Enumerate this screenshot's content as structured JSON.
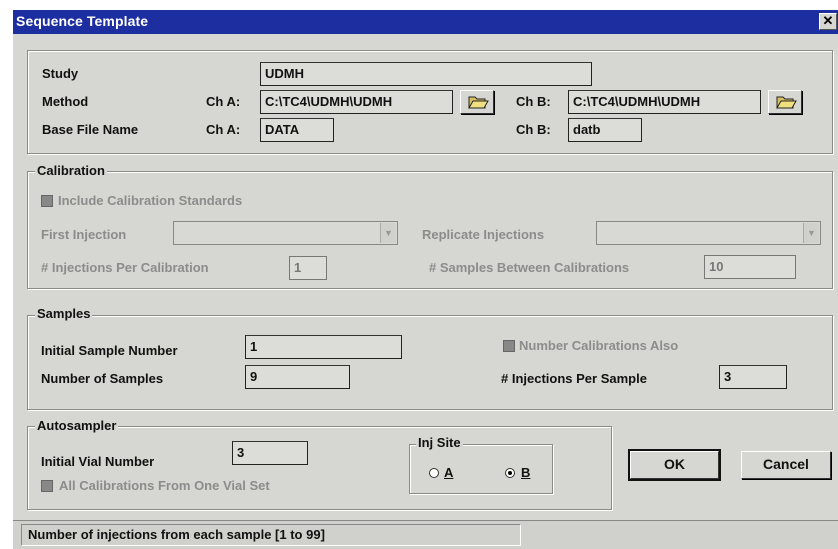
{
  "window": {
    "title": "Sequence Template",
    "close_glyph": "✕"
  },
  "header": {
    "study_label": "Study",
    "study_value": "UDMH",
    "method_label": "Method",
    "base_file_label": "Base File Name",
    "cha_label": "Ch A:",
    "chb_label": "Ch B:",
    "method_cha_value": "C:\\TC4\\UDMH\\UDMH",
    "method_chb_value": "C:\\TC4\\UDMH\\UDMH",
    "base_cha_value": "DATA",
    "base_chb_value": "datb",
    "folder_icon": "folder-open-icon"
  },
  "calibration": {
    "group_label": "Calibration",
    "include_label": "Include Calibration Standards",
    "include_checked": false,
    "first_injection_label": "First Injection",
    "first_injection_value": "",
    "replicate_label": "Replicate Injections",
    "replicate_value": "",
    "inj_per_cal_label": "# Injections Per Calibration",
    "inj_per_cal_value": "1",
    "samples_between_label": "# Samples Between Calibrations",
    "samples_between_value": "10"
  },
  "samples": {
    "group_label": "Samples",
    "initial_label": "Initial Sample Number",
    "initial_value": "1",
    "number_label": "Number of Samples",
    "number_value": "9",
    "number_cal_also_label": "Number Calibrations Also",
    "inj_per_sample_label": "# Injections Per Sample",
    "inj_per_sample_value": "3"
  },
  "autosampler": {
    "group_label": "Autosampler",
    "initial_vial_label": "Initial Vial Number",
    "initial_vial_value": "3",
    "all_cal_label": "All Calibrations From One Vial Set",
    "inj_site_label": "Inj Site",
    "site_a": "A",
    "site_b": "B",
    "selected_site": "B"
  },
  "buttons": {
    "ok": "OK",
    "cancel": "Cancel"
  },
  "status_text": "Number of injections from each sample [1 to 99]"
}
